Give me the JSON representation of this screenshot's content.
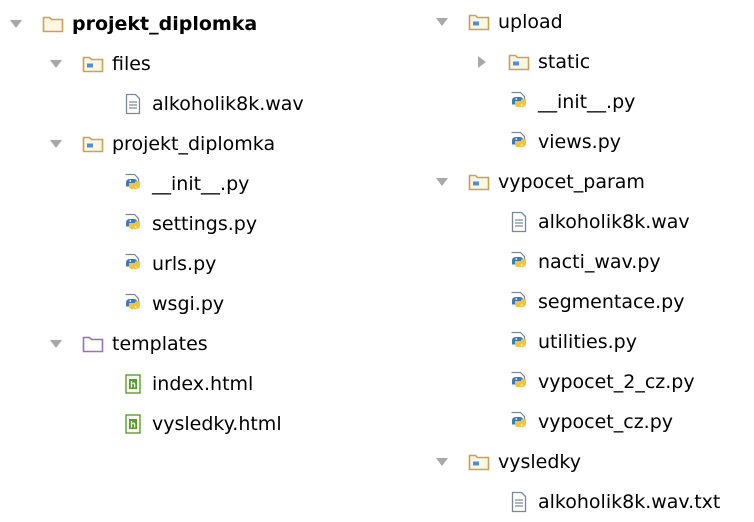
{
  "tree": {
    "left": [
      {
        "label": "projekt_diplomka",
        "type": "project-folder",
        "expanded": true,
        "depth": 0,
        "bold": true
      },
      {
        "label": "files",
        "type": "folder",
        "expanded": true,
        "depth": 1
      },
      {
        "label": "alkoholik8k.wav",
        "type": "file",
        "depth": 2
      },
      {
        "label": "projekt_diplomka",
        "type": "folder",
        "expanded": true,
        "depth": 1
      },
      {
        "label": "__init__.py",
        "type": "python",
        "depth": 2
      },
      {
        "label": "settings.py",
        "type": "python",
        "depth": 2
      },
      {
        "label": "urls.py",
        "type": "python",
        "depth": 2
      },
      {
        "label": "wsgi.py",
        "type": "python",
        "depth": 2
      },
      {
        "label": "templates",
        "type": "templates-folder",
        "expanded": true,
        "depth": 1
      },
      {
        "label": "index.html",
        "type": "html",
        "depth": 2
      },
      {
        "label": "vysledky.html",
        "type": "html",
        "depth": 2
      }
    ],
    "right": [
      {
        "label": "upload",
        "type": "folder",
        "expanded": true,
        "depth": 0
      },
      {
        "label": "static",
        "type": "folder",
        "expanded": false,
        "depth": 1
      },
      {
        "label": "__init__.py",
        "type": "python",
        "depth": 1
      },
      {
        "label": "views.py",
        "type": "python",
        "depth": 1
      },
      {
        "label": "vypocet_param",
        "type": "folder",
        "expanded": true,
        "depth": 0
      },
      {
        "label": "alkoholik8k.wav",
        "type": "file",
        "depth": 1
      },
      {
        "label": "nacti_wav.py",
        "type": "python",
        "depth": 1
      },
      {
        "label": "segmentace.py",
        "type": "python",
        "depth": 1
      },
      {
        "label": "utilities.py",
        "type": "python",
        "depth": 1
      },
      {
        "label": "vypocet_2_cz.py",
        "type": "python",
        "depth": 1
      },
      {
        "label": "vypocet_cz.py",
        "type": "python",
        "depth": 1
      },
      {
        "label": "vysledky",
        "type": "folder",
        "expanded": true,
        "depth": 0
      },
      {
        "label": "alkoholik8k.wav.txt",
        "type": "file",
        "depth": 1
      }
    ]
  },
  "colors": {
    "folder": "#c9a158",
    "folder_fill": "#fdf6e3",
    "folder_badge": "#4f8fd8",
    "templates_folder": "#9b6fc4",
    "python_blue": "#3d79b8",
    "python_yellow": "#f3c43a",
    "file_outline": "#7a8797",
    "html_green": "#5a9e2a",
    "arrow": "#a8a8a8"
  }
}
